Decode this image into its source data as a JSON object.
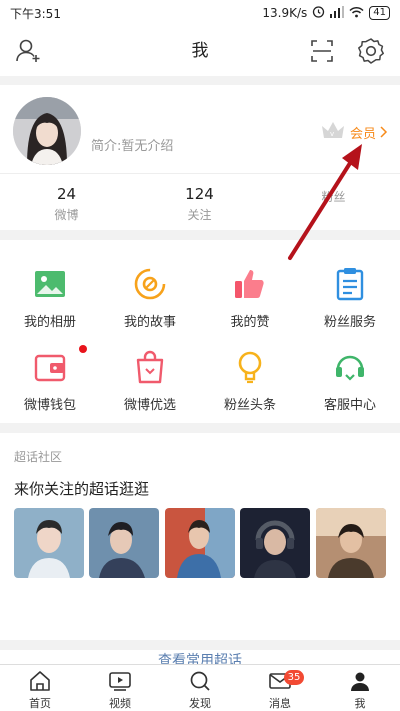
{
  "status": {
    "time": "下午3:51",
    "net_speed": "13.9K/s",
    "battery": "41"
  },
  "header": {
    "title": "我"
  },
  "profile": {
    "intro": "简介:暂无介绍",
    "vip_label": "会员",
    "stats": [
      {
        "num": "24",
        "label": "微博"
      },
      {
        "num": "124",
        "label": "关注"
      },
      {
        "num": "",
        "label": "粉丝"
      }
    ]
  },
  "grid": {
    "items": [
      {
        "label": "我的相册",
        "icon": "album-icon"
      },
      {
        "label": "我的故事",
        "icon": "story-icon"
      },
      {
        "label": "我的赞",
        "icon": "thumbs-up-icon"
      },
      {
        "label": "粉丝服务",
        "icon": "clipboard-icon"
      },
      {
        "label": "微博钱包",
        "icon": "wallet-icon"
      },
      {
        "label": "微博优选",
        "icon": "shopping-bag-icon"
      },
      {
        "label": "粉丝头条",
        "icon": "lightbulb-icon"
      },
      {
        "label": "客服中心",
        "icon": "headset-icon"
      }
    ]
  },
  "super_topic": {
    "section_label": "超话社区",
    "heading": "来你关注的超话逛逛",
    "more_link": "查看常用超话"
  },
  "tabbar": {
    "items": [
      {
        "label": "首页",
        "icon": "home-icon"
      },
      {
        "label": "视频",
        "icon": "video-icon"
      },
      {
        "label": "发现",
        "icon": "search-icon"
      },
      {
        "label": "消息",
        "icon": "mail-icon",
        "badge": "35"
      },
      {
        "label": "我",
        "icon": "profile-icon"
      }
    ]
  },
  "colors": {
    "accent_orange": "#f78a1a",
    "badge_red": "#f24a33",
    "annotation_red": "#b5121b"
  }
}
